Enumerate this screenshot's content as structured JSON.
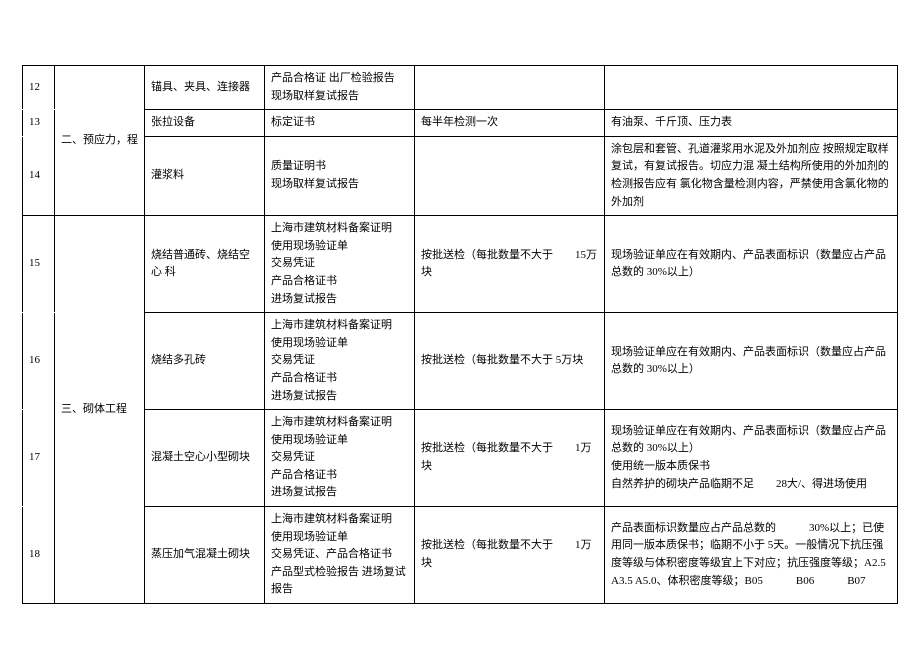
{
  "rows": {
    "r12": {
      "num": "12",
      "cat": "二、预应力，程",
      "mat": "锚具、夹具、连接器",
      "doc": "产品合格证 出厂检验报告 现场取样复试报告",
      "chk": "",
      "note": ""
    },
    "r13": {
      "num": "13",
      "mat": "张拉设备",
      "doc": "标定证书",
      "chk": "每半年检测一次",
      "note": "有油泵、千斤顶、压力表"
    },
    "r14": {
      "num": "14",
      "mat": "灌浆料",
      "doc": "质量证明书\n现场取样复试报告",
      "chk": "",
      "note": "涂包层和套管、孔道灌浆用水泥及外加剂应 按照规定取样复试，有复试报告。切应力混 凝土结构所使用的外加剂的检测报告应有 氯化物含量检测内容，严禁使用含氯化物的 外加剂"
    },
    "r15": {
      "num": "15",
      "cat": "三、砌体工程",
      "mat": "烧结普通砖、烧结空心 科",
      "doc": "上海市建筑材料备案证明\n使用现场验证单\n交易凭证\n产品合格证书\n进场复试报告",
      "chk": "按批送检（每批数量不大于　　15万块",
      "note": "现场验证单应在有效期内、产品表面标识（数量应占产品总数的 30%以上）"
    },
    "r16": {
      "num": "16",
      "mat": "烧结多孔砖",
      "doc": "上海市建筑材料备案证明\n使用现场验证单\n交易凭证\n产品合格证书\n进场复试报告",
      "chk": "按批送检（每批数量不大于 5万块",
      "note": "现场验证单应在有效期内、产品表面标识（数量应占产品总数的 30%以上）"
    },
    "r17": {
      "num": "17",
      "mat": "混凝土空心小型砌块",
      "doc": "上海市建筑材料备案证明\n使用现场验证单\n交易凭证\n产品合格证书\n进场复试报告",
      "chk": "按批送检（每批数量不大于　　1万块",
      "note": "现场验证单应在有效期内、产品表面标识（数量应占产品总数的 30%以上）\n使用统一版本质保书\n自然养护的砌块产品临期不足　　28大/、得进场使用"
    },
    "r18": {
      "num": "18",
      "mat": "蒸压加气混凝土砌块",
      "doc": "上海市建筑材料备案证明\n使用现场验证单\n交易凭证、产品合格证书\n产品型式检验报告 进场复试报告",
      "chk": "按批送检（每批数量不大于　　1万块",
      "note": "产品表面标识数量应占产品总数的　　　30%以上；已使用同一版本质保书；临期不小于 5天。一般情况下抗压强度等级与体积密度等级宜上下对应；抗压强度等级；A2.5　　　A3.5 A5.0、体积密度等级；B05　　　B06　　　B07"
    }
  }
}
